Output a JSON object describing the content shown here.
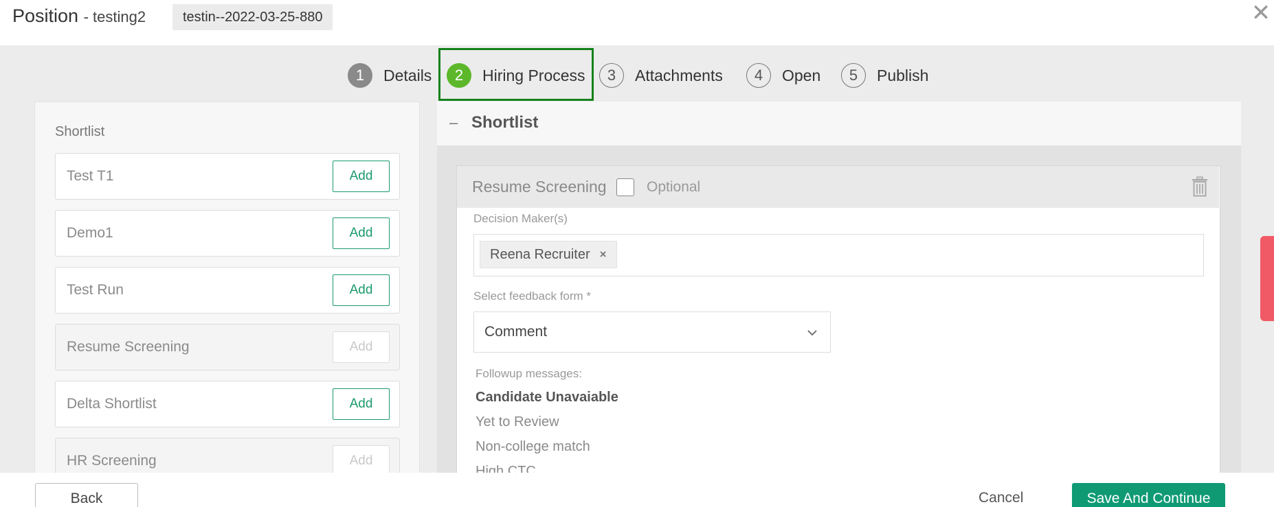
{
  "header": {
    "title": "Position",
    "subtitle": "- testing2",
    "code": "testin--2022-03-25-880",
    "close_icon": "close-icon",
    "close_glyph": "✕"
  },
  "stepper": {
    "steps": [
      {
        "num": "1",
        "label": "Details",
        "state": "completed"
      },
      {
        "num": "2",
        "label": "Hiring Process",
        "state": "active"
      },
      {
        "num": "3",
        "label": "Attachments",
        "state": "pending"
      },
      {
        "num": "4",
        "label": "Open",
        "state": "pending"
      },
      {
        "num": "5",
        "label": "Publish",
        "state": "pending"
      }
    ],
    "active_color": "#5cb82a",
    "active_frame_color": "#13811a"
  },
  "left_panel": {
    "title": "Shortlist",
    "items": [
      {
        "name": "Test T1",
        "add_label": "Add",
        "enabled": true
      },
      {
        "name": "Demo1",
        "add_label": "Add",
        "enabled": true
      },
      {
        "name": "Test Run",
        "add_label": "Add",
        "enabled": true
      },
      {
        "name": "Resume Screening",
        "add_label": "Add",
        "enabled": false
      },
      {
        "name": "Delta Shortlist",
        "add_label": "Add",
        "enabled": true
      },
      {
        "name": "HR Screening",
        "add_label": "Add",
        "enabled": false
      }
    ]
  },
  "right_panel": {
    "section_title": "Shortlist",
    "collapse_glyph": "–",
    "card": {
      "title": "Resume Screening",
      "optional_label": "Optional",
      "optional_checked": false,
      "decision_makers_label": "Decision Maker(s)",
      "decision_makers": [
        {
          "name": "Reena Recruiter",
          "remove_glyph": "×"
        }
      ],
      "feedback_form_label": "Select feedback form *",
      "feedback_form_value": "Comment",
      "followup_label": "Followup messages:",
      "followup_messages": [
        "Candidate Unavaiable",
        "Yet to Review",
        "Non-college match",
        "High CTC"
      ]
    }
  },
  "footer": {
    "back_label": "Back",
    "cancel_label": "Cancel",
    "save_label": "Save And Continue",
    "save_color": "#0f9a74"
  }
}
